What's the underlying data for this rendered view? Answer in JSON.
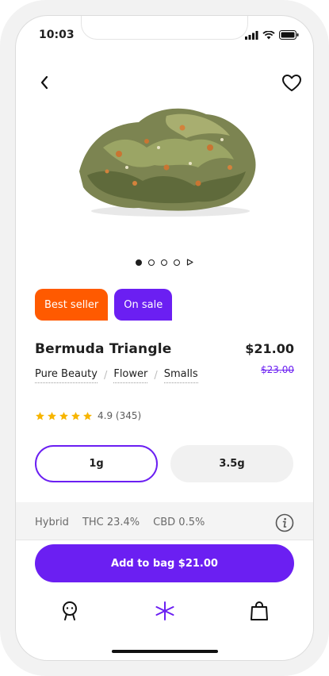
{
  "status_bar": {
    "time": "10:03"
  },
  "product": {
    "badges": [
      "Best seller",
      "On sale"
    ],
    "name": "Bermuda Triangle",
    "price": "$21.00",
    "original_price": "$23.00",
    "brand": "Pure Beauty",
    "category": "Flower",
    "size_class": "Smalls",
    "rating": 4.9,
    "rating_text": "4.9 (345)",
    "review_count": "(345)",
    "stars_filled": 5
  },
  "carousel": {
    "total": 5,
    "active_index": 0
  },
  "sizes": [
    {
      "label": "1g",
      "selected": true
    },
    {
      "label": "3.5g",
      "selected": false
    }
  ],
  "info": {
    "strain": "Hybrid",
    "thc": "THC 23.4%",
    "cbd": "CBD 0.5%"
  },
  "actions": {
    "add_to_bag": "Add to bag $21.00"
  },
  "nav": [
    "profile-icon",
    "shop-asterisk-icon",
    "bag-icon"
  ],
  "colors": {
    "accent": "#6b1ff2",
    "badge_best_seller": "#ff5a00",
    "star": "#f7b500"
  }
}
